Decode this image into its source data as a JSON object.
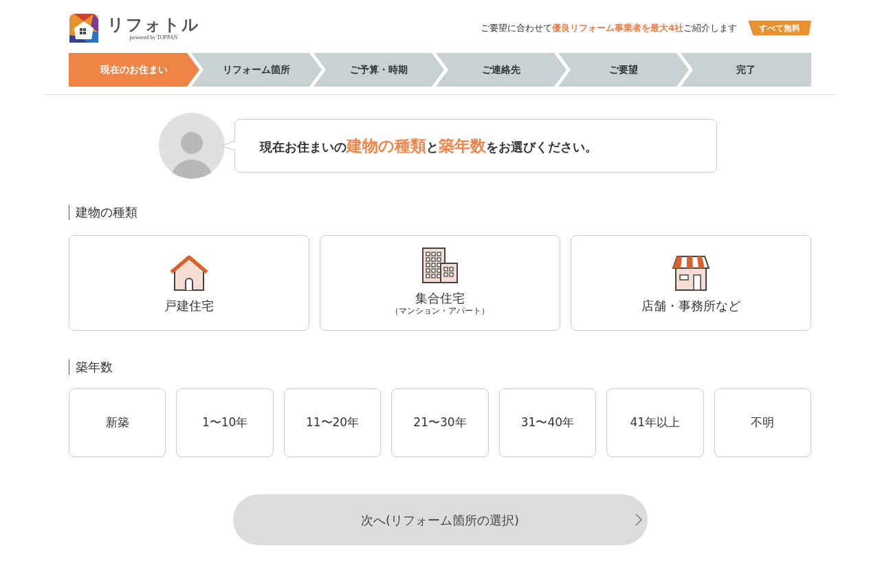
{
  "header": {
    "logo_text": "リフォトル",
    "logo_sub": "powered by TOPPAN",
    "tagline": "ご要望に合わせて**優良リフォーム事業者を最大4社**ご紹介します",
    "badge": "すべて無料"
  },
  "steps": [
    {
      "label": "現在のお住まい",
      "selected": true
    },
    {
      "label": "リフォーム箇所",
      "selected": false
    },
    {
      "label": "ご予算・時期",
      "selected": false
    },
    {
      "label": "ご連絡先",
      "selected": false
    },
    {
      "label": "ご要望",
      "selected": false
    },
    {
      "label": "完了",
      "selected": false
    }
  ],
  "message": "現在お住まいの**建物の種類**と**築年数**をお選びください。",
  "building_section": {
    "title": "建物の種類",
    "options": [
      {
        "kind": "house",
        "label": "戸建住宅",
        "selected": false
      },
      {
        "kind": "apartment",
        "label": "集合住宅",
        "sublabel": "（マンション・アパート）",
        "selected": false
      },
      {
        "kind": "shop",
        "label": "店舗・事務所など",
        "selected": false
      }
    ]
  },
  "age_section": {
    "title": "築年数",
    "options": [
      {
        "label": "新築",
        "selected": false
      },
      {
        "label": "1〜10年",
        "selected": false
      },
      {
        "label": "11〜20年",
        "selected": false
      },
      {
        "label": "21〜30年",
        "selected": false
      },
      {
        "label": "31〜40年",
        "selected": false
      },
      {
        "label": "41年以上",
        "selected": false
      },
      {
        "label": "不明",
        "selected": false
      }
    ]
  },
  "next_button": {
    "label": "次へ(リフォーム箇所の選択)",
    "disabled": true
  }
}
